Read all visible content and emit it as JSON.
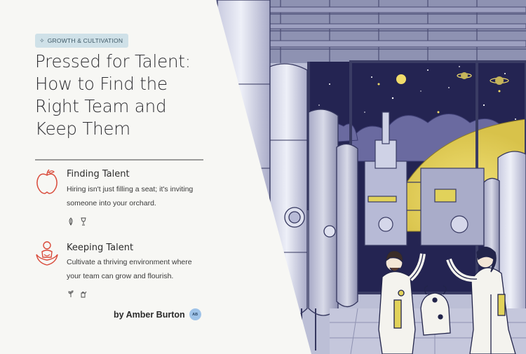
{
  "article": {
    "category": "GROWTH & CULTIVATION",
    "title": "Pressed for Talent:\nHow to Find the\nRight Team and\nKeep Them",
    "sections": [
      {
        "heading": "Finding Talent",
        "body": "Hiring isn't just filling a seat; it's inviting someone into your orchard.",
        "icon": "apple-icon",
        "mini_icons": [
          "leaf-icon",
          "goblet-icon"
        ]
      },
      {
        "heading": "Keeping Talent",
        "body": "Cultivate a thriving environment where your team can grow and flourish.",
        "icon": "nurture-hands-icon",
        "mini_icons": [
          "sprout-icon",
          "watering-can-icon"
        ]
      }
    ],
    "byline": "by Amber Burton",
    "author_initials": "AB"
  },
  "colors": {
    "accent_red": "#d94a3a",
    "tag_background": "#cfe1e8",
    "night_sky": "#242452",
    "planet_yellow": "#e6d35a"
  }
}
